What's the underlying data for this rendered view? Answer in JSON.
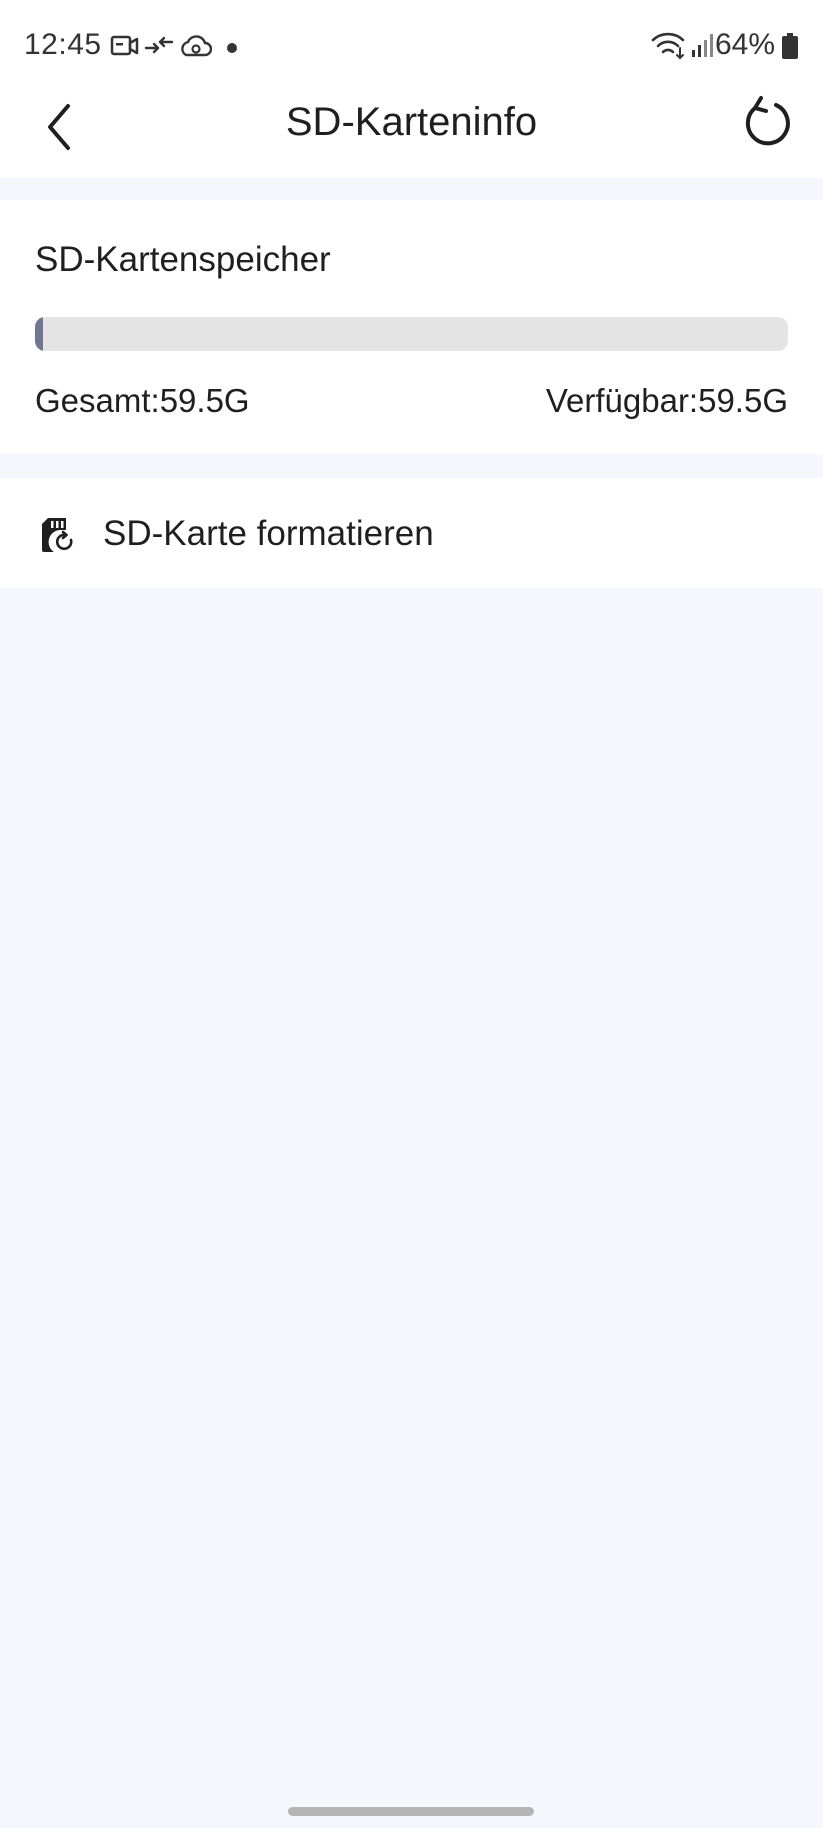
{
  "status_bar": {
    "time": "12:45",
    "battery_percent": "64%",
    "icons": [
      "video-camera-icon",
      "data-transfer-icon",
      "cloud-sync-icon",
      "notification-dot-icon",
      "wifi-icon",
      "signal-icon",
      "battery-icon"
    ]
  },
  "header": {
    "title": "SD-Karteninfo",
    "back_icon": "chevron-left-icon",
    "refresh_icon": "refresh-icon"
  },
  "storage": {
    "title": "SD-Kartenspeicher",
    "used_fraction": 0.01,
    "total_label": "Gesamt:59.5G",
    "available_label": "Verfügbar:59.5G",
    "colors": {
      "track": "#e4e4e4",
      "fill": "#6e7691"
    }
  },
  "format": {
    "label": "SD-Karte formatieren",
    "icon": "sd-card-format-icon"
  },
  "colors": {
    "background": "#f4f7fc",
    "surface": "#ffffff",
    "text": "#1f1f1f"
  }
}
